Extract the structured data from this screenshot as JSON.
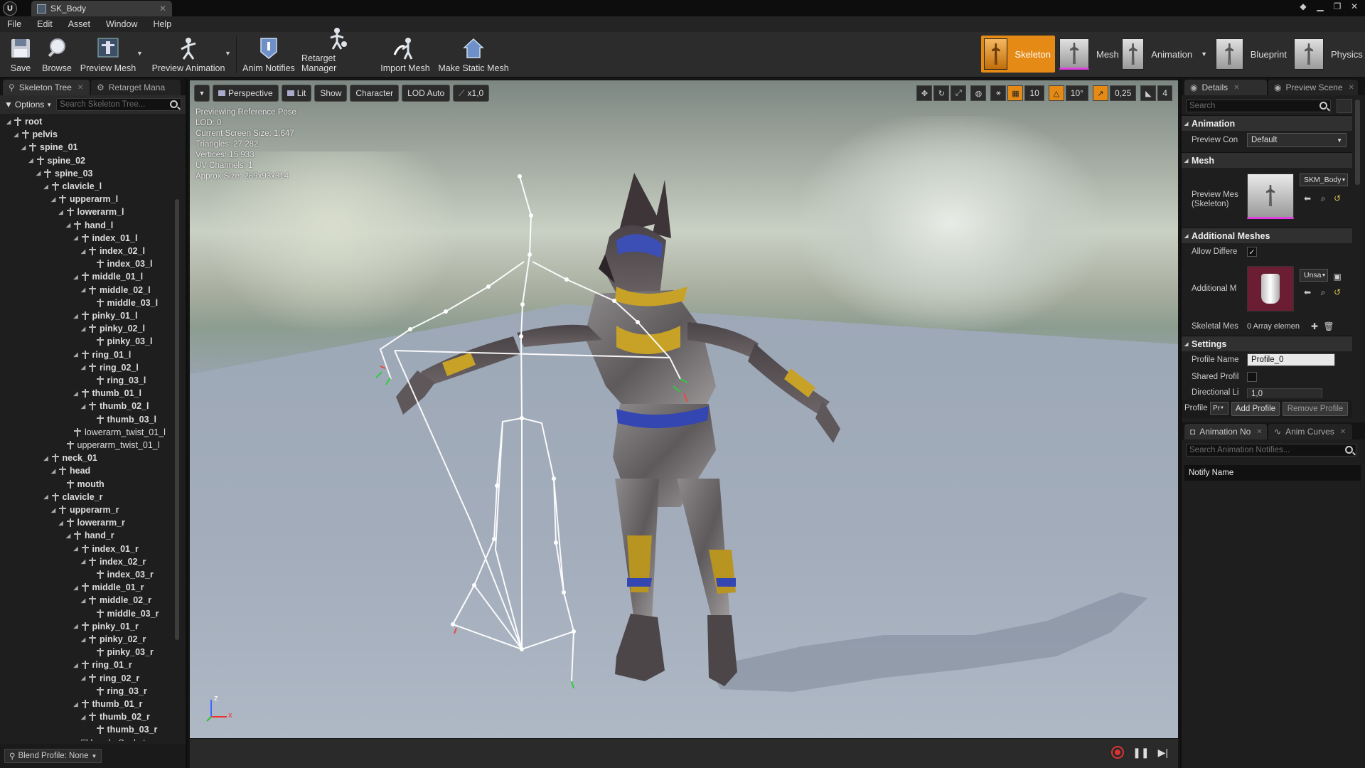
{
  "window": {
    "tab_title": "SK_Body",
    "logo": "U"
  },
  "menu": [
    "File",
    "Edit",
    "Asset",
    "Window",
    "Help"
  ],
  "toolbar": {
    "save": "Save",
    "browse": "Browse",
    "preview_mesh": "Preview Mesh",
    "preview_animation": "Preview Animation",
    "anim_notifies": "Anim Notifies",
    "retarget_manager": "Retarget Manager",
    "import_mesh": "Import Mesh",
    "make_static_mesh": "Make Static Mesh"
  },
  "modes": {
    "skeleton": "Skeleton",
    "mesh": "Mesh",
    "animation": "Animation",
    "blueprint": "Blueprint",
    "physics": "Physics"
  },
  "left_panel": {
    "tabs": [
      "Skeleton Tree",
      "Retarget Mana"
    ],
    "options_label": "Options",
    "search_placeholder": "Search Skeleton Tree...",
    "blend_profile": "Blend Profile: None",
    "tree": [
      {
        "label": "root",
        "depth": 0,
        "bold": true
      },
      {
        "label": "pelvis",
        "depth": 1,
        "bold": true
      },
      {
        "label": "spine_01",
        "depth": 2,
        "bold": true
      },
      {
        "label": "spine_02",
        "depth": 3,
        "bold": true
      },
      {
        "label": "spine_03",
        "depth": 4,
        "bold": true
      },
      {
        "label": "clavicle_l",
        "depth": 5,
        "bold": true
      },
      {
        "label": "upperarm_l",
        "depth": 6,
        "bold": true
      },
      {
        "label": "lowerarm_l",
        "depth": 7,
        "bold": true
      },
      {
        "label": "hand_l",
        "depth": 8,
        "bold": true
      },
      {
        "label": "index_01_l",
        "depth": 9,
        "bold": true
      },
      {
        "label": "index_02_l",
        "depth": 10,
        "bold": true
      },
      {
        "label": "index_03_l",
        "depth": 11,
        "bold": true
      },
      {
        "label": "middle_01_l",
        "depth": 9,
        "bold": true
      },
      {
        "label": "middle_02_l",
        "depth": 10,
        "bold": true
      },
      {
        "label": "middle_03_l",
        "depth": 11,
        "bold": true
      },
      {
        "label": "pinky_01_l",
        "depth": 9,
        "bold": true
      },
      {
        "label": "pinky_02_l",
        "depth": 10,
        "bold": true
      },
      {
        "label": "pinky_03_l",
        "depth": 11,
        "bold": true
      },
      {
        "label": "ring_01_l",
        "depth": 9,
        "bold": true
      },
      {
        "label": "ring_02_l",
        "depth": 10,
        "bold": true
      },
      {
        "label": "ring_03_l",
        "depth": 11,
        "bold": true
      },
      {
        "label": "thumb_01_l",
        "depth": 9,
        "bold": true
      },
      {
        "label": "thumb_02_l",
        "depth": 10,
        "bold": true
      },
      {
        "label": "thumb_03_l",
        "depth": 11,
        "bold": true
      },
      {
        "label": "lowerarm_twist_01_l",
        "depth": 8,
        "bold": false
      },
      {
        "label": "upperarm_twist_01_l",
        "depth": 7,
        "bold": false
      },
      {
        "label": "neck_01",
        "depth": 5,
        "bold": true
      },
      {
        "label": "head",
        "depth": 6,
        "bold": true
      },
      {
        "label": "mouth",
        "depth": 7,
        "bold": true
      },
      {
        "label": "clavicle_r",
        "depth": 5,
        "bold": true
      },
      {
        "label": "upperarm_r",
        "depth": 6,
        "bold": true
      },
      {
        "label": "lowerarm_r",
        "depth": 7,
        "bold": true
      },
      {
        "label": "hand_r",
        "depth": 8,
        "bold": true
      },
      {
        "label": "index_01_r",
        "depth": 9,
        "bold": true
      },
      {
        "label": "index_02_r",
        "depth": 10,
        "bold": true
      },
      {
        "label": "index_03_r",
        "depth": 11,
        "bold": true
      },
      {
        "label": "middle_01_r",
        "depth": 9,
        "bold": true
      },
      {
        "label": "middle_02_r",
        "depth": 10,
        "bold": true
      },
      {
        "label": "middle_03_r",
        "depth": 11,
        "bold": true
      },
      {
        "label": "pinky_01_r",
        "depth": 9,
        "bold": true
      },
      {
        "label": "pinky_02_r",
        "depth": 10,
        "bold": true
      },
      {
        "label": "pinky_03_r",
        "depth": 11,
        "bold": true
      },
      {
        "label": "ring_01_r",
        "depth": 9,
        "bold": true
      },
      {
        "label": "ring_02_r",
        "depth": 10,
        "bold": true
      },
      {
        "label": "ring_03_r",
        "depth": 11,
        "bold": true
      },
      {
        "label": "thumb_01_r",
        "depth": 9,
        "bold": true
      },
      {
        "label": "thumb_02_r",
        "depth": 10,
        "bold": true
      },
      {
        "label": "thumb_03_r",
        "depth": 11,
        "bold": true
      },
      {
        "label": "hand_rSocket",
        "depth": 9,
        "bold": false,
        "socket": true
      }
    ]
  },
  "viewport": {
    "menu_icon": "chevron-down-icon",
    "perspective": "Perspective",
    "lit": "Lit",
    "show": "Show",
    "character": "Character",
    "lod": "LOD Auto",
    "speed": "x1,0",
    "grid_snap": "10",
    "rot_snap": "10°",
    "scale_snap": "0,25",
    "cam_speed": "4",
    "info": [
      "Previewing Reference Pose",
      "LOD: 0",
      "Current Screen Size: 1,647",
      "Triangles: 27 282",
      "Vertices: 15 933",
      "UV Channels: 1",
      "Approx Size: 289x93x314"
    ],
    "axis_x": "x",
    "axis_z": "z"
  },
  "right_panel": {
    "tabs": [
      "Details",
      "Preview Scene"
    ],
    "search_placeholder": "Search",
    "animation_section": "Animation",
    "preview_controller_label": "Preview Con",
    "preview_controller_value": "Default",
    "mesh_section": "Mesh",
    "preview_mesh_label": "Preview Mes (Skeleton)",
    "preview_mesh_value": "SKM_Body",
    "additional_meshes_section": "Additional Meshes",
    "allow_different_label": "Allow Differe",
    "additional_mesh_label": "Additional M",
    "additional_mesh_value": "Unsa",
    "skeletal_meshes_label": "Skeletal Mes",
    "skeletal_meshes_value": "0 Array elemen",
    "settings_section": "Settings",
    "profile_name_label": "Profile Name",
    "profile_name_value": "Profile_0",
    "shared_profile_label": "Shared Profil",
    "directional_label": "Directional Li",
    "directional_value": "1,0",
    "profile_label": "Profile",
    "profile_value": "Pr",
    "add_profile": "Add Profile",
    "remove_profile": "Remove Profile",
    "bottom_tabs": [
      "Animation No",
      "Anim Curves"
    ],
    "notify_search_placeholder": "Search Animation Notifies...",
    "notify_name_header": "Notify Name"
  },
  "colors": {
    "accent": "#e58a14",
    "panel": "#1e1e1e",
    "toolbar": "#2c2c2c"
  }
}
